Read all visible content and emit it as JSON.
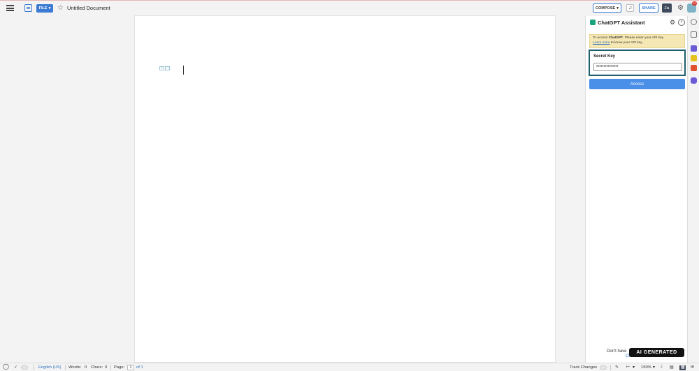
{
  "header": {
    "file_label": "FILE",
    "doc_title": "Untitled Document",
    "compose_label": "COMPOSE",
    "share_label": "SHARE",
    "zia_label": "Zia",
    "notification_badge": "10"
  },
  "panel": {
    "title": "ChatGPT Assistant",
    "notice_prefix": "To access ",
    "notice_brand": "ChatGPT",
    "notice_mid": ". Please enter your API key.",
    "notice_link": "Learn more",
    "notice_suffix": " to know your API key.",
    "key_label": "Secret Key",
    "key_value": "•••••••••••••••",
    "access_label": "Access",
    "footer_text": "Don't have",
    "footer_link": "Click"
  },
  "watermark": "AI GENERATED",
  "status": {
    "language": "English (US)",
    "words_label": "Words:",
    "words_value": "0",
    "chars_label": "Chars:",
    "chars_value": "0",
    "page_label": "Page:",
    "page_value": "1",
    "page_total": "of 1",
    "track_changes": "Track Changes",
    "zoom": "150%"
  }
}
